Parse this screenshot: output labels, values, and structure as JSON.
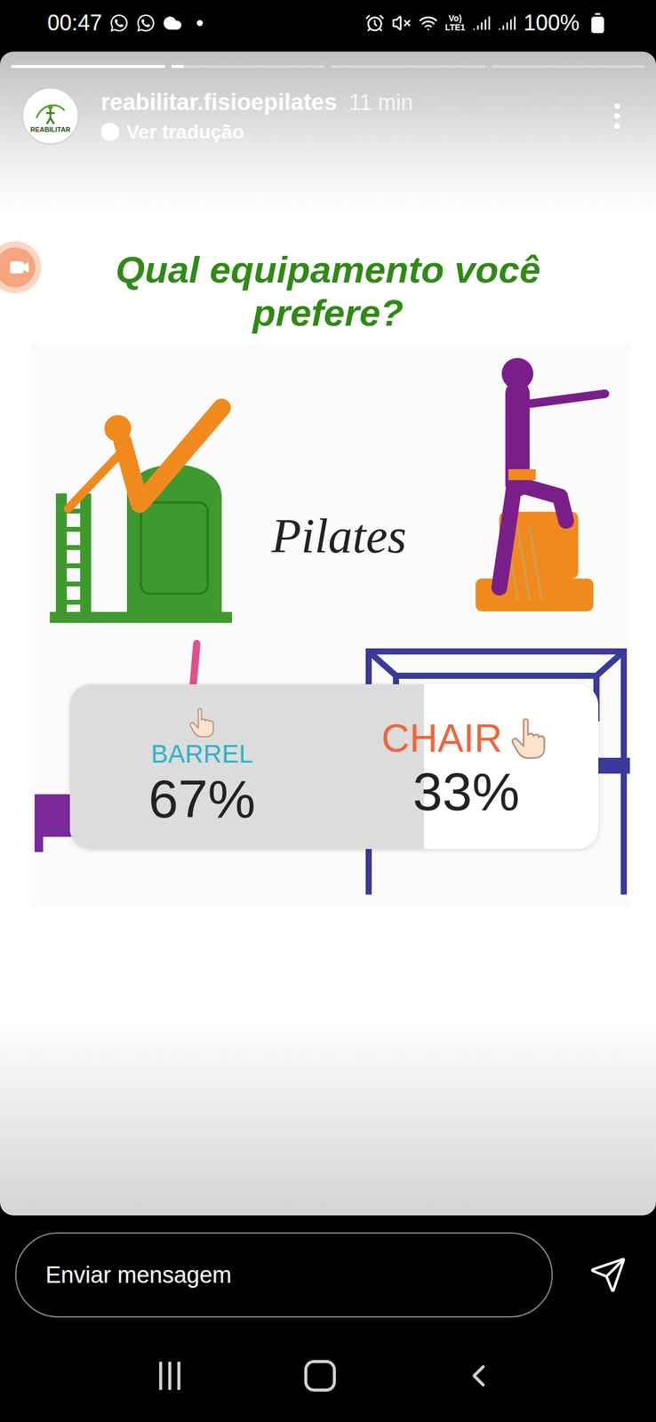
{
  "status_bar": {
    "time": "00:47",
    "volte": "Vo)",
    "lte": "LTE1",
    "battery": "100%"
  },
  "progress": [
    {
      "level": 1
    },
    {
      "level": 0.08
    },
    {
      "level": 0
    },
    {
      "level": 0
    }
  ],
  "header": {
    "avatar_text": "REABILITAR",
    "username": "reabilitar.fisioepilates",
    "time": "11 min",
    "translate": "Ver tradução"
  },
  "title": "Qual equipamento você prefere?",
  "image": {
    "caption": "Pilates"
  },
  "poll": {
    "options": [
      {
        "label": "BARREL",
        "percent": "67%",
        "level": 0.67,
        "color": "#2bb3c9",
        "kind": "stacked"
      },
      {
        "label": "CHAIR",
        "percent": "33%",
        "level": 0.33,
        "color": "#f0653c",
        "kind": "inline"
      }
    ]
  },
  "message_bar": {
    "placeholder": "Enviar mensagem"
  }
}
